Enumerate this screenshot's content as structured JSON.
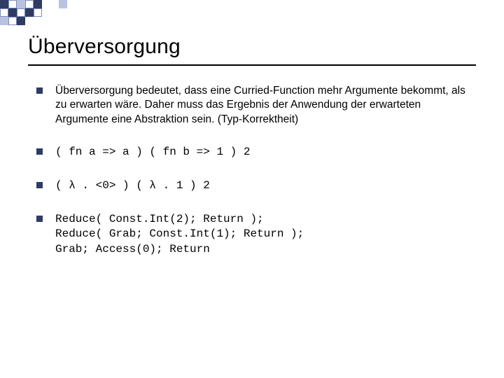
{
  "title": "Überversorgung",
  "bullets": [
    {
      "kind": "text",
      "text": "Überversorgung bedeutet, dass eine Curried-Function mehr Argumente bekommt, als zu erwarten wäre.\nDaher muss das Ergebnis der Anwendung der erwarteten Argumente eine Abstraktion sein. (Typ-Korrektheit)"
    },
    {
      "kind": "mono",
      "text": "( fn a => a ) ( fn b => 1 ) 2"
    },
    {
      "kind": "mono",
      "text": "( λ . <0> ) ( λ . 1 ) 2"
    },
    {
      "kind": "mono",
      "text": "Reduce( Const.Int(2); Return );\nReduce( Grab; Const.Int(1); Return );\nGrab; Access(0); Return"
    }
  ],
  "decor": {
    "accent_dark": "#2f3b63",
    "accent_light": "#b9c3e0",
    "outline": "#7a8bbf"
  }
}
